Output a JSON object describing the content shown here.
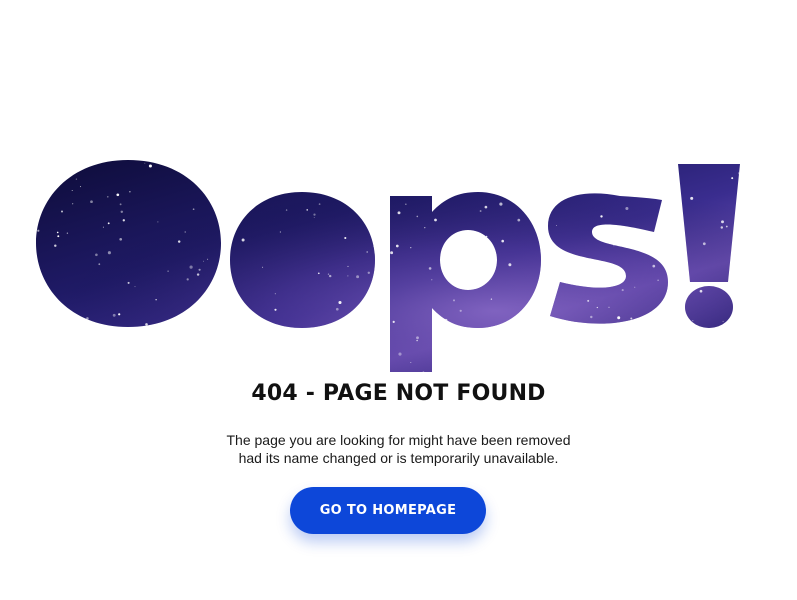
{
  "hero": {
    "text": "Oops!",
    "fill_colors": [
      "#0b0a33",
      "#1f1a66",
      "#3a2d8f",
      "#6a4fb3",
      "#8b6cc7"
    ]
  },
  "error": {
    "title": "404 - PAGE NOT FOUND",
    "message_line1": "The page you are looking for might have been removed",
    "message_line2": "had its name changed or is temporarily unavailable."
  },
  "actions": {
    "home_label": "GO TO HOMEPAGE",
    "home_color": "#0d47d9"
  }
}
